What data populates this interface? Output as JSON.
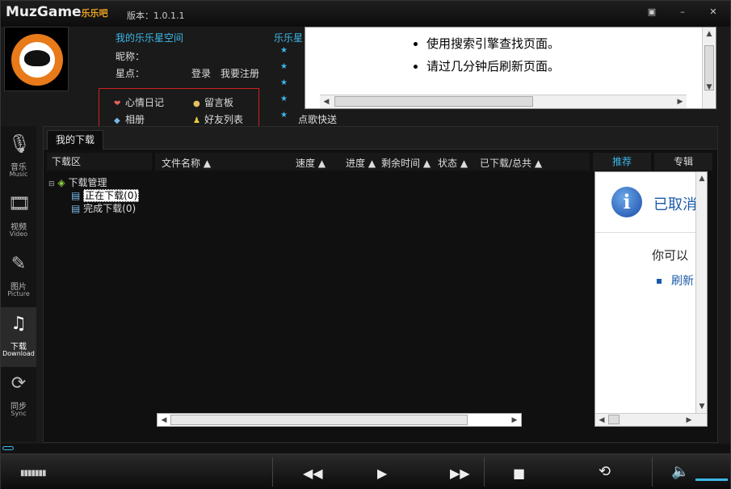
{
  "app": {
    "logo_text": "MuzGame",
    "logo_cn": "乐乐吧",
    "version": "版本：1.0.1.1"
  },
  "profile": {
    "space_title": "我的乐乐星空间",
    "nick_label": "昵称：",
    "points_label": "星点：",
    "login": "登录",
    "register": "我要注册",
    "quick_links": [
      "心情日记",
      "留言板",
      "相册",
      "好友列表"
    ]
  },
  "music_star": {
    "title": "乐乐星",
    "jukebox": "点歌快送"
  },
  "top_error": {
    "lines": [
      "使用搜索引擎查找页面。",
      "请过几分钟后刷新页面。"
    ]
  },
  "nav": [
    {
      "cn": "音乐",
      "en": "Music",
      "icon": "music-icon"
    },
    {
      "cn": "视频",
      "en": "Video",
      "icon": "film-icon"
    },
    {
      "cn": "图片",
      "en": "Picture",
      "icon": "picture-icon"
    },
    {
      "cn": "下载",
      "en": "Download",
      "icon": "download-icon"
    },
    {
      "cn": "同步",
      "en": "Sync",
      "icon": "sync-icon"
    }
  ],
  "main": {
    "tab": "我的下载",
    "tree_header": "下载区",
    "tree_root": "下载管理",
    "tree_children": [
      "正在下载(0)",
      "完成下载(0)"
    ],
    "columns": [
      "文件名称",
      "速度",
      "进度",
      "剩余时间",
      "状态",
      "已下载/总共"
    ],
    "right_tabs": [
      "推荐",
      "专辑"
    ]
  },
  "side_error": {
    "title": "已取消",
    "text": "你可以",
    "link": "刷新"
  }
}
